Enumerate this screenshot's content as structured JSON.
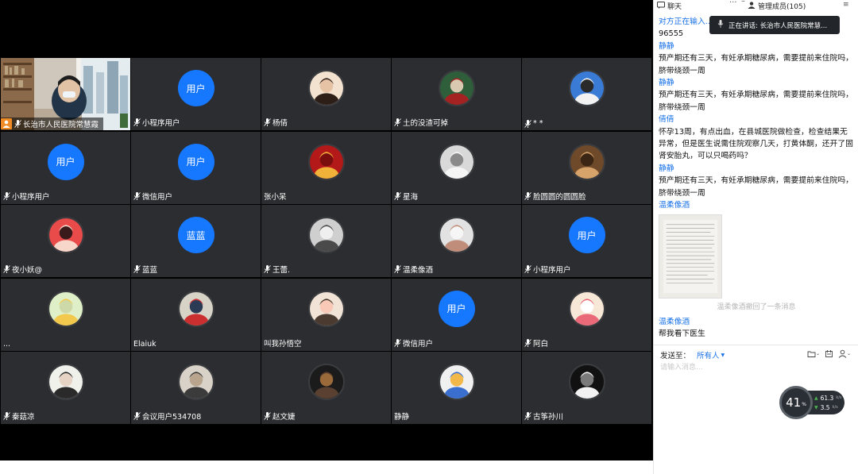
{
  "grid": {
    "participants": [
      {
        "name": "长治市人民医院常慧霞",
        "type": "video",
        "host": true
      },
      {
        "name": "小程序用户",
        "type": "text",
        "avatar_text": "用户"
      },
      {
        "name": "杨倩",
        "type": "img",
        "palette": [
          "#f3e2cf",
          "#2d1e18",
          "#e7c3a5"
        ]
      },
      {
        "name": "土的没渣可掉",
        "type": "img",
        "palette": [
          "#2f5f3a",
          "#a52222",
          "#d9c9b1"
        ]
      },
      {
        "name": "* *",
        "type": "img",
        "palette": [
          "#3a7bd5",
          "#f2f2f2",
          "#2a2a2a"
        ]
      },
      {
        "name": "小程序用户",
        "type": "text",
        "avatar_text": "用户"
      },
      {
        "name": "微信用户",
        "type": "text",
        "avatar_text": "用户"
      },
      {
        "name": "张小呆",
        "type": "img",
        "palette": [
          "#b31919",
          "#f1b23a",
          "#7a0d0d"
        ],
        "no_mic": true
      },
      {
        "name": "星海",
        "type": "img",
        "palette": [
          "#d9d9d9",
          "#f5f5f5",
          "#8a8a8a"
        ]
      },
      {
        "name": "脸圆圆的圆圆脸",
        "type": "img",
        "palette": [
          "#6e4a2a",
          "#d6a36b",
          "#3b2514"
        ]
      },
      {
        "name": "夜小妖@",
        "type": "img",
        "palette": [
          "#e94a4a",
          "#f7d7c9",
          "#3a1a1a"
        ]
      },
      {
        "name": "蓝蓝",
        "type": "text",
        "avatar_text": "蓝蓝"
      },
      {
        "name": "王蕾.",
        "type": "img",
        "palette": [
          "#cfcfcf",
          "#4a4a4a",
          "#efefef"
        ]
      },
      {
        "name": "温柔像酒",
        "type": "img",
        "palette": [
          "#e2e2e2",
          "#c08d7a",
          "#f6f6f6"
        ]
      },
      {
        "name": "小程序用户",
        "type": "text",
        "avatar_text": "用户"
      },
      {
        "name": "...",
        "type": "img",
        "palette": [
          "#dff0c8",
          "#f2c94c",
          "#cdd9a8"
        ],
        "no_mic": true
      },
      {
        "name": "Elaiuk",
        "type": "img",
        "palette": [
          "#d8d3c7",
          "#cc2f2f",
          "#2b3a55"
        ],
        "no_mic": true
      },
      {
        "name": "叫我孙悟空",
        "type": "img",
        "palette": [
          "#f1e3d6",
          "#4b3a2f",
          "#f7c9b6"
        ],
        "no_mic": true
      },
      {
        "name": "微信用户",
        "type": "text",
        "avatar_text": "用户"
      },
      {
        "name": "阿白",
        "type": "img",
        "palette": [
          "#f7e7d6",
          "#ea6a7a",
          "#ffffff"
        ]
      },
      {
        "name": "秦菇凉",
        "type": "img",
        "palette": [
          "#f1f1ec",
          "#2a2a2a",
          "#e6d3c3"
        ]
      },
      {
        "name": "会议用户534708",
        "type": "img",
        "palette": [
          "#d9d2c8",
          "#3b3b3b",
          "#b9a48e"
        ]
      },
      {
        "name": "赵文婕",
        "type": "img",
        "palette": [
          "#1b1b1b",
          "#5a4030",
          "#9a6a3a"
        ]
      },
      {
        "name": "静静",
        "type": "img",
        "palette": [
          "#f0f0f0",
          "#3a6fd0",
          "#f2b84a"
        ],
        "no_mic": true
      },
      {
        "name": "古筝孙川",
        "type": "img",
        "palette": [
          "#111111",
          "#f2f2f2",
          "#7a7a7a"
        ]
      }
    ]
  },
  "panel": {
    "tab_chat": "聊天",
    "tab_dots": "···",
    "tab_min": "–",
    "tab_members": "管理成员(105)",
    "tab_menu": "≡",
    "speaking_label": "正在讲话: 长治市人民医院常慧...",
    "chat": {
      "typing": "对方正在输入...",
      "first_msg": "96555",
      "messages": [
        {
          "sender": "静静",
          "text": "预产期还有三天，有妊承期糖尿病，需要提前来住院吗，脐带绕颈一周"
        },
        {
          "sender": "静静",
          "text": "预产期还有三天，有妊承期糖尿病，需要提前来住院吗，脐带绕颈一周"
        },
        {
          "sender": "倩倩",
          "text": "怀孕13周，有点出血，在县城医院做检查，检查结果无异常，但是医生说需住院观察几天，打黄体酮，还开了固肾安胎丸，可以只喝药吗？"
        },
        {
          "sender": "静静",
          "text": "预产期还有三天，有妊承期糖尿病，需要提前来住院吗，脐带绕颈一周"
        }
      ],
      "image_sender": "温柔像酒",
      "recall_notice": "温柔像酒撤回了一条消息",
      "last_sender": "温柔像酒",
      "last_text": "帮我看下医生"
    },
    "send_to_label": "发送至：",
    "send_target": "所有人",
    "input_placeholder": "请输入消息...",
    "net": {
      "score": "41",
      "score_unit": "%",
      "up": "61.3",
      "down": "3.5",
      "rate_unit": "k/s"
    }
  }
}
